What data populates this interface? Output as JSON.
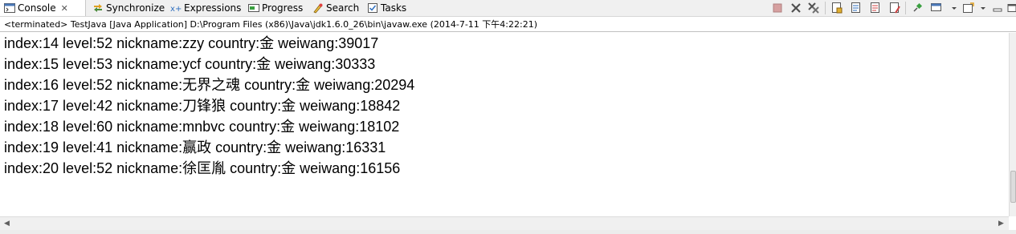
{
  "tabs": [
    {
      "label": "Console",
      "icon": "console-icon",
      "active": true
    },
    {
      "label": "Synchronize",
      "icon": "synchronize-icon"
    },
    {
      "label": "Expressions",
      "icon": "expressions-icon"
    },
    {
      "label": "Progress",
      "icon": "progress-icon"
    },
    {
      "label": "Search",
      "icon": "search-icon"
    },
    {
      "label": "Tasks",
      "icon": "tasks-icon"
    }
  ],
  "close_glyph": "✕",
  "process_description": "<terminated> TestJava [Java Application] D:\\Program Files (x86)\\Java\\jdk1.6.0_26\\bin\\javaw.exe (2014-7-11 下午4:22:21)",
  "console_lines": [
    "index:14 level:52 nickname:zzy country:金 weiwang:39017",
    "index:15 level:53 nickname:ycf country:金 weiwang:30333",
    "index:16 level:52 nickname:无界之魂 country:金 weiwang:20294",
    "index:17 level:42 nickname:刀锋狼 country:金 weiwang:18842",
    "index:18 level:60 nickname:mnbvc country:金 weiwang:18102",
    "index:19 level:41 nickname:赢政 country:金 weiwang:16331",
    "index:20 level:52 nickname:徐匡胤 country:金 weiwang:16156"
  ],
  "toolbar_icons": [
    "terminate-icon",
    "remove-launch-icon",
    "remove-all-terminated-icon",
    "scroll-lock-icon",
    "show-on-stdout-icon",
    "show-on-stderr-icon",
    "clear-console-icon",
    "pin-console-icon",
    "display-console-icon",
    "open-console-icon",
    "minimize-icon",
    "maximize-icon"
  ],
  "colors": {
    "terminate_disabled": "#c8c8c8",
    "remove": "#505050",
    "accent": "#2f6fbf"
  }
}
